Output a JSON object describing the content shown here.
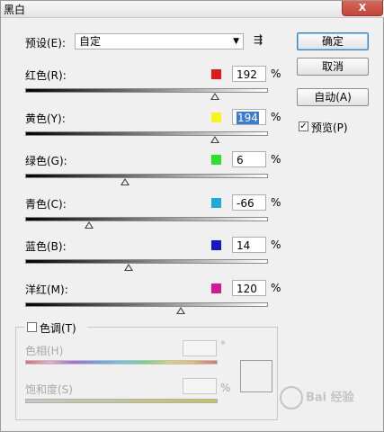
{
  "window": {
    "title": "黑白",
    "close_label": "X"
  },
  "preset": {
    "label": "预设(E):",
    "value": "自定",
    "arrow": "▼",
    "menu_icon": "⇶"
  },
  "channels": [
    {
      "label": "红色(R):",
      "value": "192",
      "unit": "%",
      "color": "#e21a1a"
    },
    {
      "label": "黄色(Y):",
      "value": "194",
      "unit": "%",
      "color": "#f5f51a"
    },
    {
      "label": "绿色(G):",
      "value": "6",
      "unit": "%",
      "color": "#2be12b"
    },
    {
      "label": "青色(C):",
      "value": "-66",
      "unit": "%",
      "color": "#1fa8e0"
    },
    {
      "label": "蓝色(B):",
      "value": "14",
      "unit": "%",
      "color": "#1419c8"
    },
    {
      "label": "洋红(M):",
      "value": "120",
      "unit": "%",
      "color": "#d4188e"
    }
  ],
  "buttons": {
    "ok": "确定",
    "cancel": "取消",
    "auto": "自动(A)"
  },
  "preview": {
    "label": "预览(P)",
    "checked": true,
    "check_mark": "✓"
  },
  "tint": {
    "label": "色调(T)",
    "checked": false,
    "hue_label": "色相(H)",
    "hue_unit": "°",
    "saturation_label": "饱和度(S)",
    "saturation_unit": "%"
  },
  "watermark": "Bai 经验"
}
